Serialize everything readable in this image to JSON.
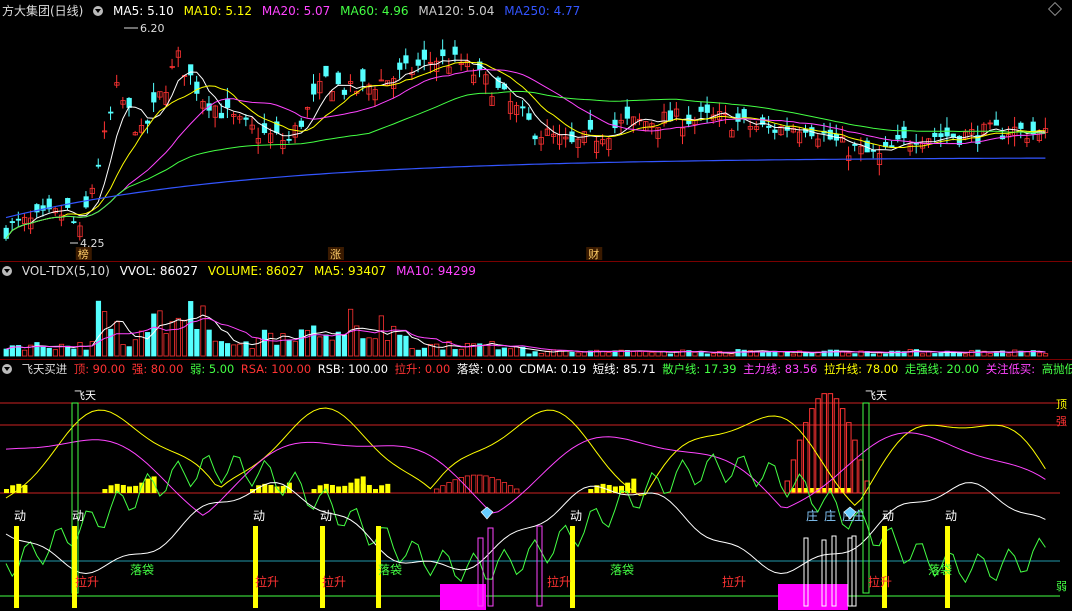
{
  "main_panel": {
    "stock_name": "方大集团(日线)",
    "indicators": [
      {
        "label": "MA5: 5.10",
        "color": "#ffffff"
      },
      {
        "label": "MA10: 5.12",
        "color": "#ffff00"
      },
      {
        "label": "MA20: 5.07",
        "color": "#ff44ff"
      },
      {
        "label": "MA60: 4.96",
        "color": "#44ff44"
      },
      {
        "label": "MA120: 5.04",
        "color": "#cccccc"
      },
      {
        "label": "MA250: 4.77",
        "color": "#3355ff"
      }
    ],
    "high_label": "6.20",
    "low_label": "4.25",
    "markers": [
      {
        "text": "榜",
        "x_index": 12
      },
      {
        "text": "涨",
        "x_index": 53
      },
      {
        "text": "财",
        "x_index": 95
      }
    ]
  },
  "vol_panel": {
    "title": "VOL-TDX(5,10)",
    "items": [
      {
        "label": "VVOL: 86027",
        "color": "#ffffff"
      },
      {
        "label": "VOLUME: 86027",
        "color": "#ffff00"
      },
      {
        "label": "MA5: 93407",
        "color": "#ffff00"
      },
      {
        "label": "MA10: 94299",
        "color": "#ff44ff"
      }
    ]
  },
  "ind_panel": {
    "title": "飞天买进",
    "items": [
      {
        "label": "顶: 90.00",
        "color": "#ff3333"
      },
      {
        "label": "强: 80.00",
        "color": "#ff3333"
      },
      {
        "label": "弱: 5.00",
        "color": "#44ff44"
      },
      {
        "label": "RSA: 100.00",
        "color": "#ff3333"
      },
      {
        "label": "RSB: 100.00",
        "color": "#ffffff"
      },
      {
        "label": "拉升: 0.00",
        "color": "#ff3333"
      },
      {
        "label": "落袋: 0.00",
        "color": "#ffffff"
      },
      {
        "label": "CDMA: 0.19",
        "color": "#ffffff"
      },
      {
        "label": "短线: 85.71",
        "color": "#ffffff"
      },
      {
        "label": "散户线: 17.39",
        "color": "#44ff44"
      },
      {
        "label": "主力线: 83.56",
        "color": "#ff44ff"
      },
      {
        "label": "拉升线: 78.00",
        "color": "#ffff00"
      },
      {
        "label": "走强线: 20.00",
        "color": "#44ff44"
      },
      {
        "label": "关注低买:",
        "color": "#ff44ff"
      },
      {
        "label": "高抛低吸",
        "color": "#44ff44"
      }
    ],
    "level_labels": {
      "ding": "顶",
      "qiang": "强",
      "ruo": "弱"
    },
    "feitian": "飞天",
    "dong": "动",
    "zhuang": "庄",
    "lasheng": "拉升",
    "luodai": "落袋"
  },
  "colors": {
    "up": "#ff3333",
    "down": "#55ffff",
    "ma5": "#ffffff",
    "ma10": "#ffff00",
    "ma20": "#ff44ff",
    "ma60": "#44ff44",
    "ma250": "#3355ff"
  }
}
